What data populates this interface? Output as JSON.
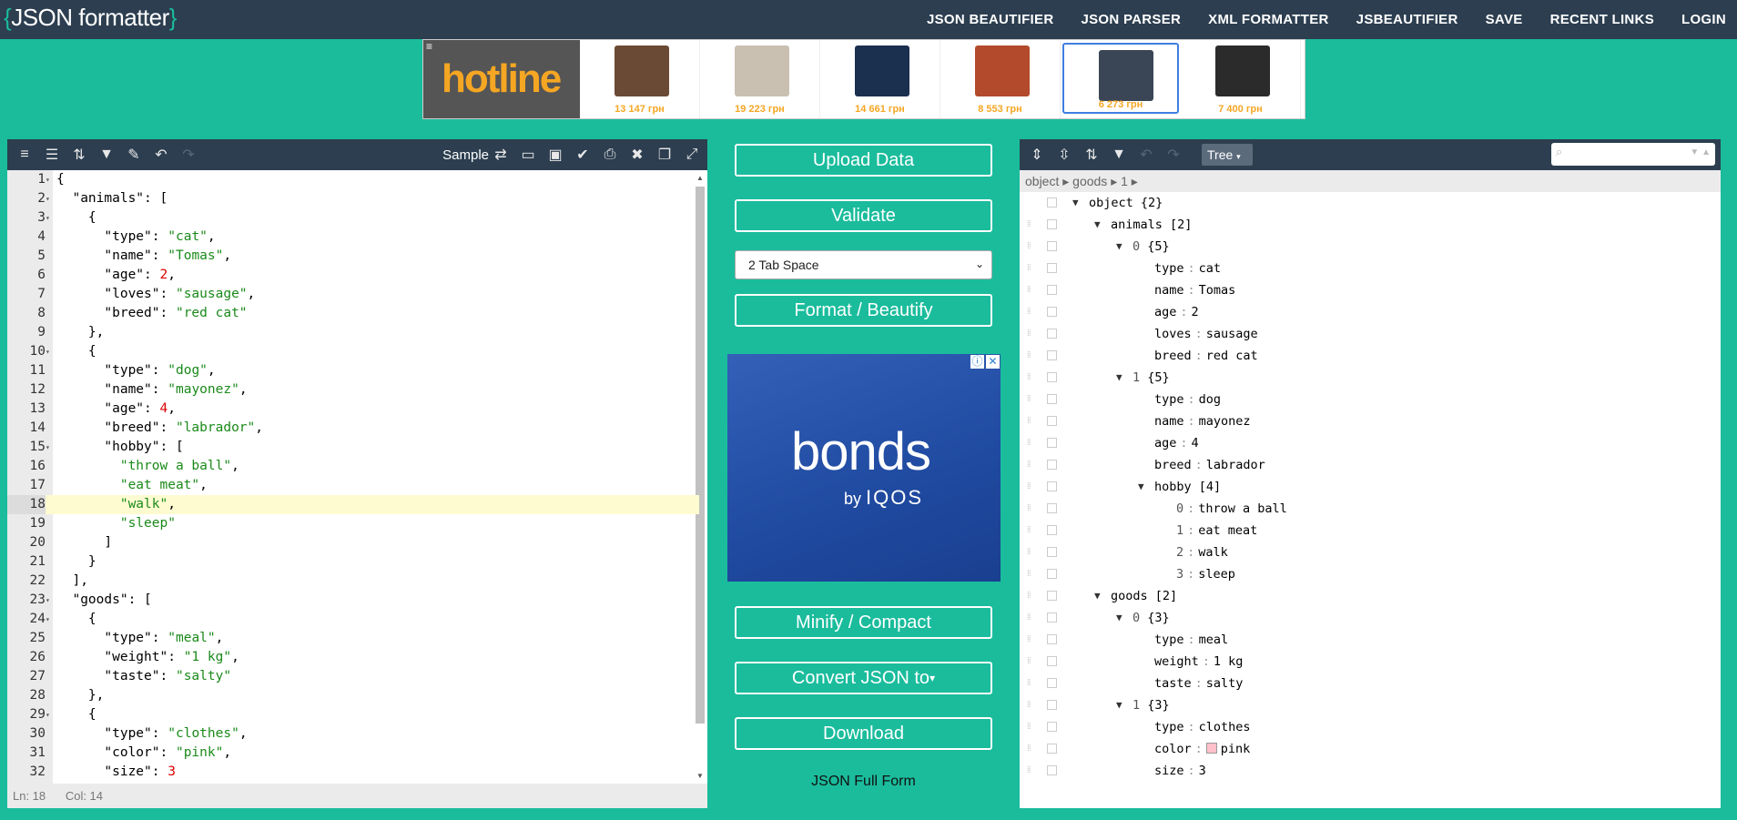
{
  "header": {
    "logo_open": "{",
    "logo_text": "JSON formatter",
    "logo_close": "}",
    "nav": [
      "JSON BEAUTIFIER",
      "JSON PARSER",
      "XML FORMATTER",
      "JSBEAUTIFIER",
      "SAVE",
      "RECENT LINKS",
      "LOGIN"
    ]
  },
  "banner": {
    "brand": "hotline",
    "menu_glyph": "≡",
    "products": [
      {
        "price": "13 147 грн",
        "color": "#6b4a35"
      },
      {
        "price": "19 223 грн",
        "color": "#c9c0b2"
      },
      {
        "price": "14 661 грн",
        "color": "#1b2f4f"
      },
      {
        "price": "8 553 грн",
        "color": "#b24a2b"
      },
      {
        "price": "6 273 грн",
        "color": "#3a4656"
      },
      {
        "price": "7 400 грн",
        "color": "#2b2b2b"
      }
    ]
  },
  "editor": {
    "sample_label": "Sample",
    "status_ln": "Ln: 18",
    "status_col": "Col: 14",
    "active_line": 18,
    "lines": [
      {
        "n": "1",
        "fold": "▾",
        "html": "{"
      },
      {
        "n": "2",
        "fold": "▾",
        "html": "  <span class=\"k\">\"animals\"</span>: ["
      },
      {
        "n": "3",
        "fold": "▾",
        "html": "    {"
      },
      {
        "n": "4",
        "fold": "",
        "html": "      <span class=\"k\">\"type\"</span>: <span class=\"s\">\"cat\"</span>,"
      },
      {
        "n": "5",
        "fold": "",
        "html": "      <span class=\"k\">\"name\"</span>: <span class=\"s\">\"Tomas\"</span>,"
      },
      {
        "n": "6",
        "fold": "",
        "html": "      <span class=\"k\">\"age\"</span>: <span class=\"n\">2</span>,"
      },
      {
        "n": "7",
        "fold": "",
        "html": "      <span class=\"k\">\"loves\"</span>: <span class=\"s\">\"sausage\"</span>,"
      },
      {
        "n": "8",
        "fold": "",
        "html": "      <span class=\"k\">\"breed\"</span>: <span class=\"s\">\"red cat\"</span>"
      },
      {
        "n": "9",
        "fold": "",
        "html": "    },"
      },
      {
        "n": "10",
        "fold": "▾",
        "html": "    {"
      },
      {
        "n": "11",
        "fold": "",
        "html": "      <span class=\"k\">\"type\"</span>: <span class=\"s\">\"dog\"</span>,"
      },
      {
        "n": "12",
        "fold": "",
        "html": "      <span class=\"k\">\"name\"</span>: <span class=\"s\">\"mayonez\"</span>,"
      },
      {
        "n": "13",
        "fold": "",
        "html": "      <span class=\"k\">\"age\"</span>: <span class=\"n\">4</span>,"
      },
      {
        "n": "14",
        "fold": "",
        "html": "      <span class=\"k\">\"breed\"</span>: <span class=\"s\">\"labrador\"</span>,"
      },
      {
        "n": "15",
        "fold": "▾",
        "html": "      <span class=\"k\">\"hobby\"</span>: ["
      },
      {
        "n": "16",
        "fold": "",
        "html": "        <span class=\"s\">\"throw a ball\"</span>,"
      },
      {
        "n": "17",
        "fold": "",
        "html": "        <span class=\"s\">\"eat meat\"</span>,"
      },
      {
        "n": "18",
        "fold": "",
        "html": "        <span class=\"s\">\"walk\"</span>,"
      },
      {
        "n": "19",
        "fold": "",
        "html": "        <span class=\"s\">\"sleep\"</span>"
      },
      {
        "n": "20",
        "fold": "",
        "html": "      ]"
      },
      {
        "n": "21",
        "fold": "",
        "html": "    }"
      },
      {
        "n": "22",
        "fold": "",
        "html": "  ],"
      },
      {
        "n": "23",
        "fold": "▾",
        "html": "  <span class=\"k\">\"goods\"</span>: ["
      },
      {
        "n": "24",
        "fold": "▾",
        "html": "    {"
      },
      {
        "n": "25",
        "fold": "",
        "html": "      <span class=\"k\">\"type\"</span>: <span class=\"s\">\"meal\"</span>,"
      },
      {
        "n": "26",
        "fold": "",
        "html": "      <span class=\"k\">\"weight\"</span>: <span class=\"s\">\"1 kg\"</span>,"
      },
      {
        "n": "27",
        "fold": "",
        "html": "      <span class=\"k\">\"taste\"</span>: <span class=\"s\">\"salty\"</span>"
      },
      {
        "n": "28",
        "fold": "",
        "html": "    },"
      },
      {
        "n": "29",
        "fold": "▾",
        "html": "    {"
      },
      {
        "n": "30",
        "fold": "",
        "html": "      <span class=\"k\">\"type\"</span>: <span class=\"s\">\"clothes\"</span>,"
      },
      {
        "n": "31",
        "fold": "",
        "html": "      <span class=\"k\">\"color\"</span>: <span class=\"s\">\"pink\"</span>,"
      },
      {
        "n": "32",
        "fold": "",
        "html": "      <span class=\"k\">\"size\"</span>: <span class=\"n\">3</span>"
      }
    ]
  },
  "actions": {
    "upload": "Upload Data",
    "validate": "Validate",
    "indent_selected": "2 Tab Space",
    "format": "Format / Beautify",
    "minify": "Minify / Compact",
    "convert": "Convert JSON to",
    "download": "Download",
    "full_form": "JSON Full Form"
  },
  "ad": {
    "brand": "bonds",
    "by": "by",
    "maker": "IQOS",
    "ad_info": "ⓘ",
    "ad_close": "✕"
  },
  "viewer": {
    "mode": "Tree",
    "breadcrumb": "object ▸ goods ▸ 1 ▸",
    "rows": [
      {
        "indent": 0,
        "tog": "▼",
        "key": "object",
        "meta": "{2}"
      },
      {
        "indent": 1,
        "tog": "▼",
        "key": "animals",
        "meta": "[2]"
      },
      {
        "indent": 2,
        "tog": "▼",
        "idx": "0",
        "meta": "{5}"
      },
      {
        "indent": 3,
        "key": "type",
        "val": "cat"
      },
      {
        "indent": 3,
        "key": "name",
        "val": "Tomas"
      },
      {
        "indent": 3,
        "key": "age",
        "val": "2"
      },
      {
        "indent": 3,
        "key": "loves",
        "val": "sausage"
      },
      {
        "indent": 3,
        "key": "breed",
        "val": "red cat"
      },
      {
        "indent": 2,
        "tog": "▼",
        "idx": "1",
        "meta": "{5}"
      },
      {
        "indent": 3,
        "key": "type",
        "val": "dog"
      },
      {
        "indent": 3,
        "key": "name",
        "val": "mayonez"
      },
      {
        "indent": 3,
        "key": "age",
        "val": "4"
      },
      {
        "indent": 3,
        "key": "breed",
        "val": "labrador"
      },
      {
        "indent": 3,
        "tog": "▼",
        "key": "hobby",
        "meta": "[4]"
      },
      {
        "indent": 4,
        "idx": "0",
        "val": "throw a ball"
      },
      {
        "indent": 4,
        "idx": "1",
        "val": "eat meat"
      },
      {
        "indent": 4,
        "idx": "2",
        "val": "walk"
      },
      {
        "indent": 4,
        "idx": "3",
        "val": "sleep"
      },
      {
        "indent": 1,
        "tog": "▼",
        "key": "goods",
        "meta": "[2]"
      },
      {
        "indent": 2,
        "tog": "▼",
        "idx": "0",
        "meta": "{3}"
      },
      {
        "indent": 3,
        "key": "type",
        "val": "meal"
      },
      {
        "indent": 3,
        "key": "weight",
        "val": "1 kg"
      },
      {
        "indent": 3,
        "key": "taste",
        "val": "salty"
      },
      {
        "indent": 2,
        "tog": "▼",
        "idx": "1",
        "meta": "{3}"
      },
      {
        "indent": 3,
        "key": "type",
        "val": "clothes"
      },
      {
        "indent": 3,
        "key": "color",
        "val": "pink",
        "swatch": "#ffc0cb"
      },
      {
        "indent": 3,
        "key": "size",
        "val": "3"
      }
    ]
  },
  "colors": {
    "accent": "#1abc9c",
    "navbar": "#2c3e50",
    "price": "#f5a623"
  }
}
